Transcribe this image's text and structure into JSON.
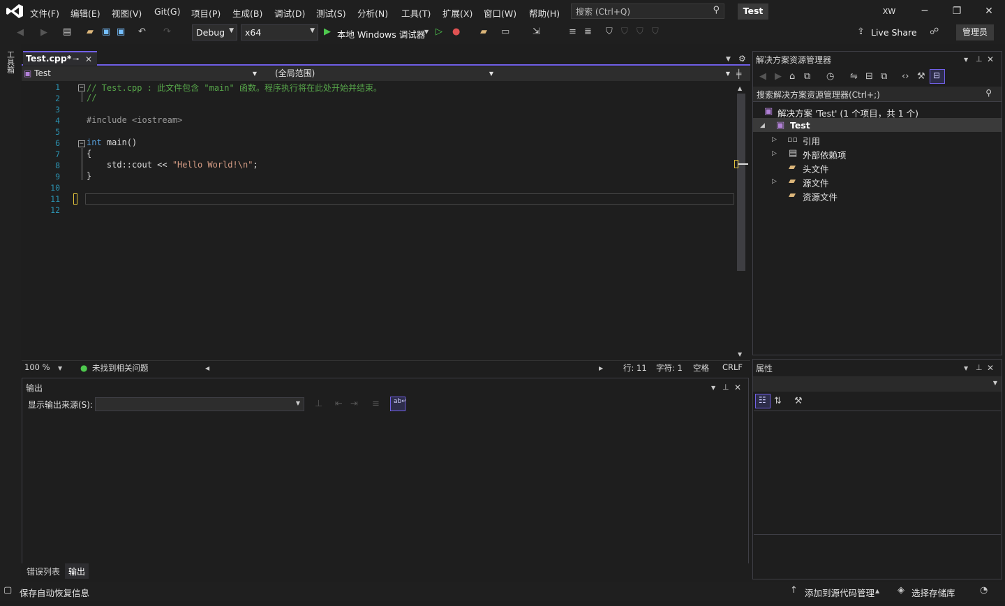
{
  "menu": [
    "文件(F)",
    "编辑(E)",
    "视图(V)",
    "Git(G)",
    "项目(P)",
    "生成(B)",
    "调试(D)",
    "测试(S)",
    "分析(N)",
    "工具(T)",
    "扩展(X)",
    "窗口(W)",
    "帮助(H)"
  ],
  "search": {
    "placeholder": "搜索 (Ctrl+Q)"
  },
  "solution_name": "Test",
  "user_initials": "XW",
  "toolbar": {
    "config": "Debug",
    "platform": "x64",
    "run_label": "本地 Windows 调试器",
    "live_share": "Live Share",
    "admin": "管理员"
  },
  "toolbox_label": "工具箱",
  "editor": {
    "tab_title": "Test.cpp*",
    "nav_project": "Test",
    "nav_scope": "(全局范围)",
    "lines": [
      {
        "n": "1",
        "text": "// Test.cpp : 此文件包含 \"main\" 函数。程序执行将在此处开始并结束。"
      },
      {
        "n": "2",
        "text": "//"
      },
      {
        "n": "3",
        "text": ""
      },
      {
        "n": "4",
        "text": "#include <iostream>"
      },
      {
        "n": "5",
        "text": ""
      },
      {
        "n": "6",
        "text": "int main()"
      },
      {
        "n": "7",
        "text": "{"
      },
      {
        "n": "8",
        "text": "    std::cout << \"Hello World!\\n\";"
      },
      {
        "n": "9",
        "text": "}"
      },
      {
        "n": "10",
        "text": ""
      },
      {
        "n": "11",
        "text": ""
      },
      {
        "n": "12",
        "text": ""
      }
    ],
    "zoom": "100 %",
    "issues": "未找到相关问题",
    "line_pos": "行: 11",
    "col_pos": "字符: 1",
    "whitespace": "空格",
    "line_ending": "CRLF"
  },
  "output": {
    "title": "输出",
    "source_label": "显示输出来源(S):"
  },
  "bottom_tabs": [
    "错误列表",
    "输出"
  ],
  "solution_explorer": {
    "title": "解决方案资源管理器",
    "search_placeholder": "搜索解决方案资源管理器(Ctrl+;)",
    "solution_item": "解决方案 'Test' (1 个项目，共 1 个)",
    "project": "Test",
    "items": [
      "引用",
      "外部依赖项",
      "头文件",
      "源文件",
      "资源文件"
    ]
  },
  "properties": {
    "title": "属性"
  },
  "statusbar": {
    "left": "保存自动恢复信息",
    "source_control": "添加到源代码管理",
    "repo": "选择存储库"
  },
  "colors": {
    "accent": "#7160e8",
    "bg": "#1e1e1e",
    "comment": "#57a64a",
    "keyword": "#569cd6",
    "string": "#d69d85",
    "linenum": "#2b91af"
  }
}
